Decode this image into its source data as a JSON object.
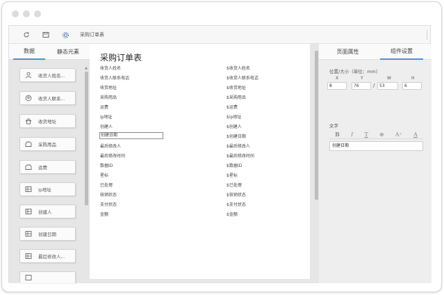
{
  "window": {
    "title": "采购订单表"
  },
  "left_panel": {
    "tabs": [
      {
        "label": "数据",
        "active": true
      },
      {
        "label": "静态元素",
        "active": false
      }
    ],
    "fields": [
      {
        "label": "收货人姓名...",
        "icon": "person-icon"
      },
      {
        "label": "收货人联系...",
        "icon": "contact-icon"
      },
      {
        "label": "收货地址",
        "icon": "home-icon"
      },
      {
        "label": "采购用品",
        "icon": "folder-icon"
      },
      {
        "label": "运费",
        "icon": "folder-icon"
      },
      {
        "label": "ip地址",
        "icon": "table-icon"
      },
      {
        "label": "创建人",
        "icon": "table-icon"
      },
      {
        "label": "创建日期",
        "icon": "table-icon"
      },
      {
        "label": "最后修改人...",
        "icon": "table-icon"
      }
    ]
  },
  "document": {
    "title": "采购订单表",
    "rows": [
      {
        "label": "收货人姓名",
        "value": "$收货人姓名"
      },
      {
        "label": "收货人联系电话",
        "value": "$收货人联系电话"
      },
      {
        "label": "收货地址",
        "value": "$收货地址"
      },
      {
        "label": "采购用品",
        "value": "$采购用品"
      },
      {
        "label": "运费",
        "value": "$运费"
      },
      {
        "label": "ip地址",
        "value": "$ip地址"
      },
      {
        "label": "创建人",
        "value": "$创建人"
      },
      {
        "label": "创建日期",
        "value": "$创建日期",
        "selected": true
      },
      {
        "label": "最后修改人",
        "value": "$最后修改人"
      },
      {
        "label": "最后修改时间",
        "value": "$最后修改时间"
      },
      {
        "label": "数据ID",
        "value": "$数据ID"
      },
      {
        "label": "星标",
        "value": "$星标"
      },
      {
        "label": "已处理",
        "value": "$已处理"
      },
      {
        "label": "核销状态",
        "value": "$核销状态"
      },
      {
        "label": "支付状态",
        "value": "$支付状态"
      },
      {
        "label": "金额",
        "value": "$金额"
      }
    ]
  },
  "right_panel": {
    "tabs": [
      {
        "label": "页面属性",
        "active": false
      },
      {
        "label": "组件设置",
        "active": true
      }
    ],
    "position_size_label": "位置/大小（单位：mm）",
    "axes": {
      "x": "X",
      "y": "Y",
      "w": "W",
      "h": "H"
    },
    "values": {
      "x": "8",
      "y": "76",
      "w": "53",
      "h": "6"
    },
    "slash": "/",
    "text_label": "文字",
    "format_buttons": [
      "B",
      "I",
      "T",
      "⊕",
      "A⁺",
      "A"
    ],
    "text_value": "创建日期"
  },
  "colors": {
    "accent": "#4a90d9",
    "panel_bg": "#e6e6e6"
  }
}
